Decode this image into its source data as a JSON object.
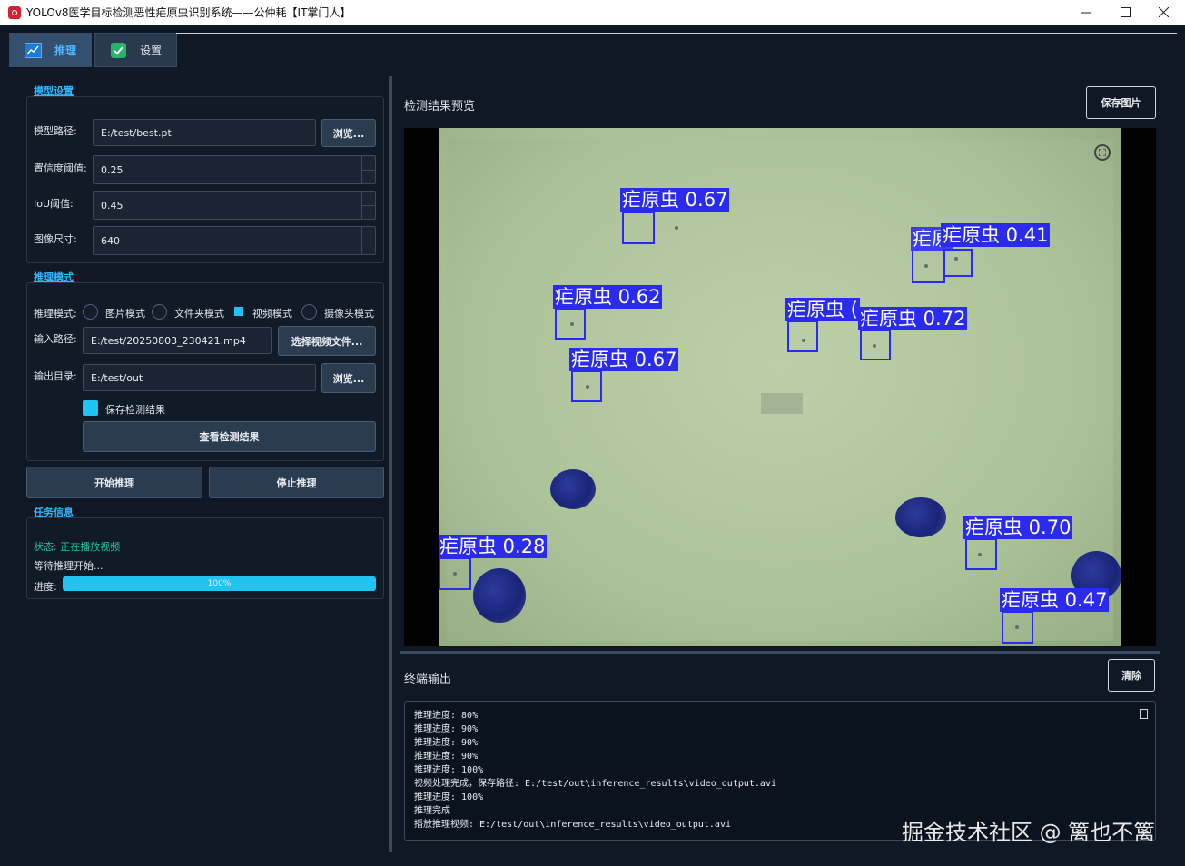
{
  "window": {
    "title": "YOLOv8医学目标检测恶性疟原虫识别系统——公仲耗【IT掌门人】"
  },
  "tabs": [
    {
      "label": "推理",
      "icon": "chart-line-icon"
    },
    {
      "label": "设置",
      "icon": "check-box-icon"
    }
  ],
  "model_settings": {
    "section_title": "模型设置",
    "model_path_label": "模型路径:",
    "model_path_value": "E:/test/best.pt",
    "browse_label": "浏览...",
    "conf_label": "置信度阈值:",
    "conf_value": "0.25",
    "iou_label": "IoU阈值:",
    "iou_value": "0.45",
    "imgsz_label": "图像尺寸:",
    "imgsz_value": "640"
  },
  "inference_mode": {
    "section_title": "推理模式",
    "mode_label": "推理模式:",
    "modes": [
      "图片模式",
      "文件夹模式",
      "视频模式",
      "摄像头模式"
    ],
    "selected_mode": "视频模式",
    "input_label": "输入路径:",
    "input_value": "E:/test/20250803_230421.mp4",
    "select_video_label": "选择视频文件...",
    "output_label": "输出目录:",
    "output_value": "E:/test/out",
    "browse_label": "浏览...",
    "save_results_label": "保存检测结果",
    "save_results_checked": true,
    "view_results_label": "查看检测结果"
  },
  "actions": {
    "start_label": "开始推理",
    "stop_label": "停止推理"
  },
  "task_info": {
    "section_title": "任务信息",
    "status_text": "状态: 正在播放视频",
    "wait_text": "等待推理开始...",
    "progress_label": "进度:",
    "progress_value": 100,
    "progress_text": "100%"
  },
  "preview": {
    "title": "检测结果预览",
    "save_label": "保存图片",
    "detections": [
      {
        "label": "疟原虫 0.67"
      },
      {
        "label": "疟原虫 0.62"
      },
      {
        "label": "疟原虫 0.67"
      },
      {
        "label": "疟原虫 0.41"
      },
      {
        "label": "疟原虫 0.72"
      },
      {
        "label": "疟原虫 0.70"
      },
      {
        "label": "疟原虫 0.28"
      },
      {
        "label": "疟原虫 0.47"
      },
      {
        "label": "疟原虫 ("
      },
      {
        "label": "疟原"
      }
    ]
  },
  "terminal": {
    "title": "终端输出",
    "clear_label": "清除",
    "lines": [
      "推理进度: 80%",
      "推理进度: 90%",
      "推理进度: 90%",
      "推理进度: 90%",
      "推理进度: 100%",
      "视频处理完成，保存路径: E:/test/out\\inference_results\\video_output.avi",
      "推理进度: 100%",
      "推理完成",
      "播放推理视频: E:/test/out\\inference_results\\video_output.avi"
    ]
  },
  "watermark": "掘金技术社区 @ 篱也不篱",
  "colors": {
    "accent": "#21c3f2",
    "section": "#2fb7ff",
    "bbox": "#2b2bf0",
    "status": "#22c39a"
  }
}
